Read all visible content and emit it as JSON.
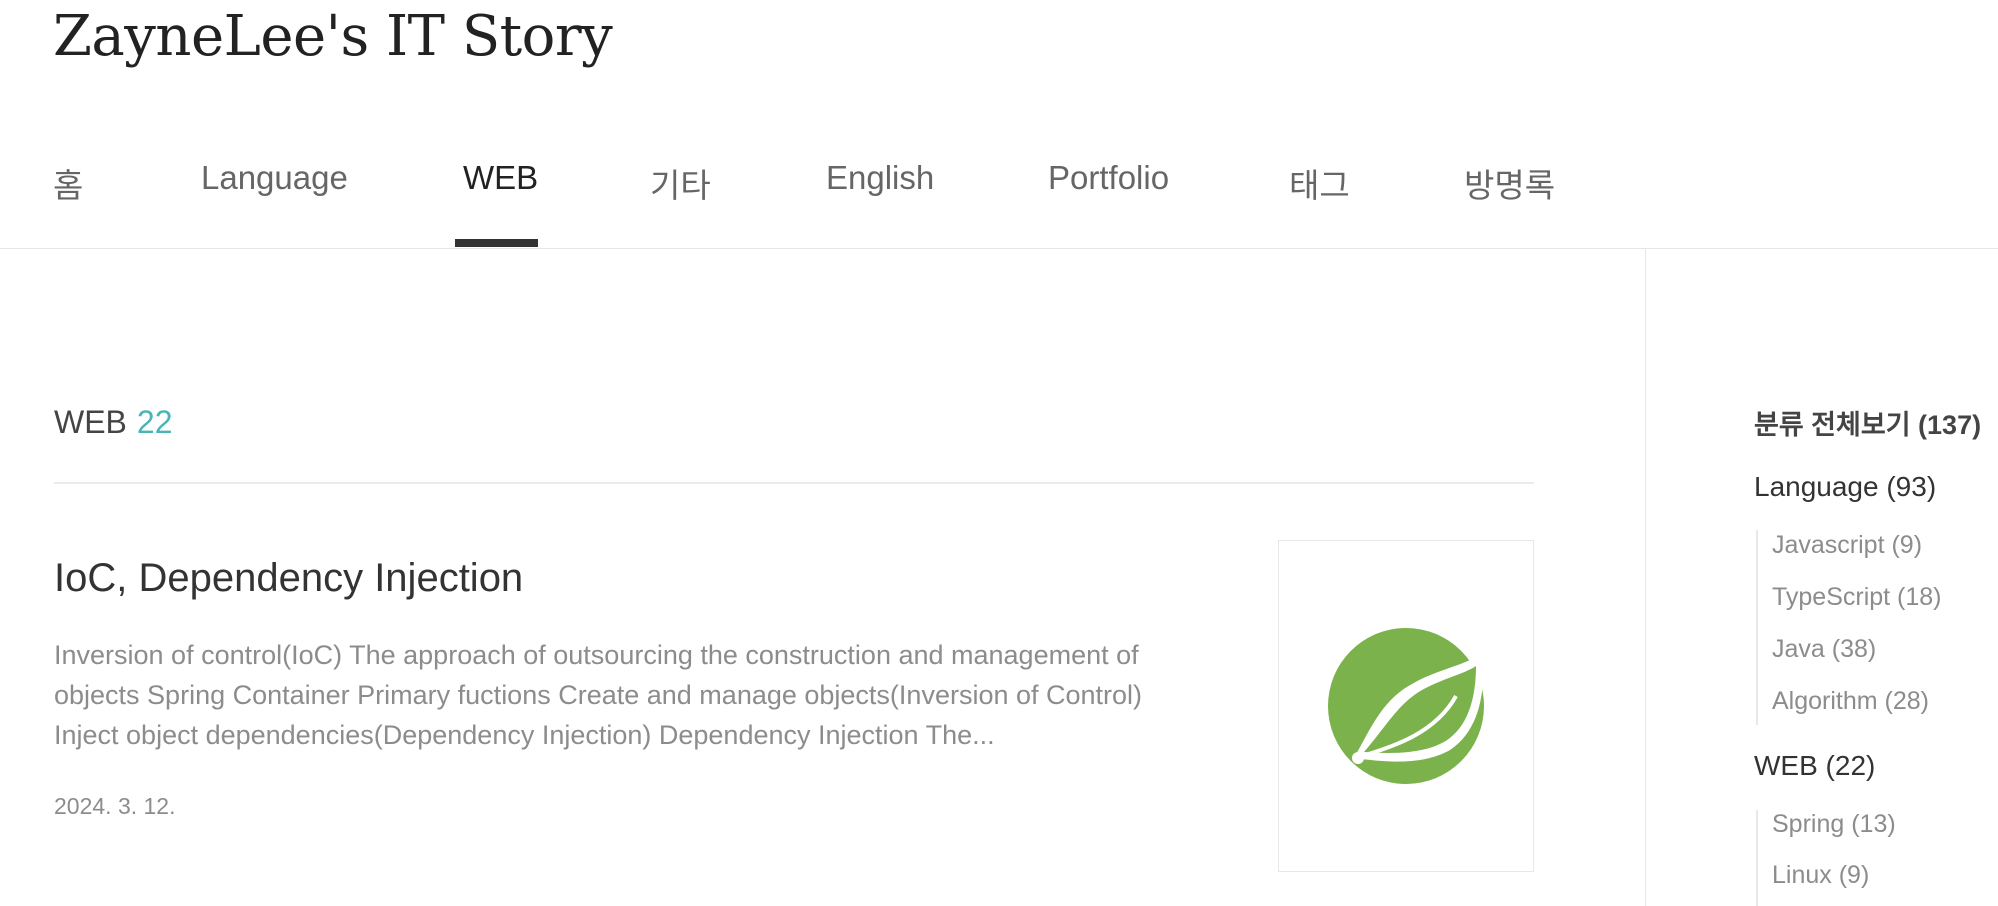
{
  "site": {
    "title": "ZayneLee's IT Story"
  },
  "nav": {
    "items": [
      "홈",
      "Language",
      "WEB",
      "기타",
      "English",
      "Portfolio",
      "태그",
      "방명록"
    ],
    "active": "WEB"
  },
  "category": {
    "name": "WEB",
    "count": "22"
  },
  "post": {
    "title": "IoC, Dependency Injection",
    "excerpt": "Inversion of control(IoC) The approach of outsourcing the construction and management of objects Spring Container Primary fuctions Create and manage objects(Inversion of Control) Inject object dependencies(Dependency Injection) Dependency Injection The...",
    "date": "2024. 3. 12.",
    "thumbnail_icon": "spring-leaf-icon",
    "thumbnail_color": "#7bb24b"
  },
  "sidebar": {
    "all_label": "분류 전체보기 (137)",
    "language": {
      "label": "Language (93)",
      "children": [
        "Javascript (9)",
        "TypeScript (18)",
        "Java (38)",
        "Algorithm (28)"
      ]
    },
    "web": {
      "label": "WEB (22)",
      "children": [
        "Spring (13)",
        "Linux (9)"
      ]
    }
  },
  "colors": {
    "accent_count": "#4ab5b5",
    "nav_active": "#222222",
    "text_muted": "#8c8c8c"
  }
}
